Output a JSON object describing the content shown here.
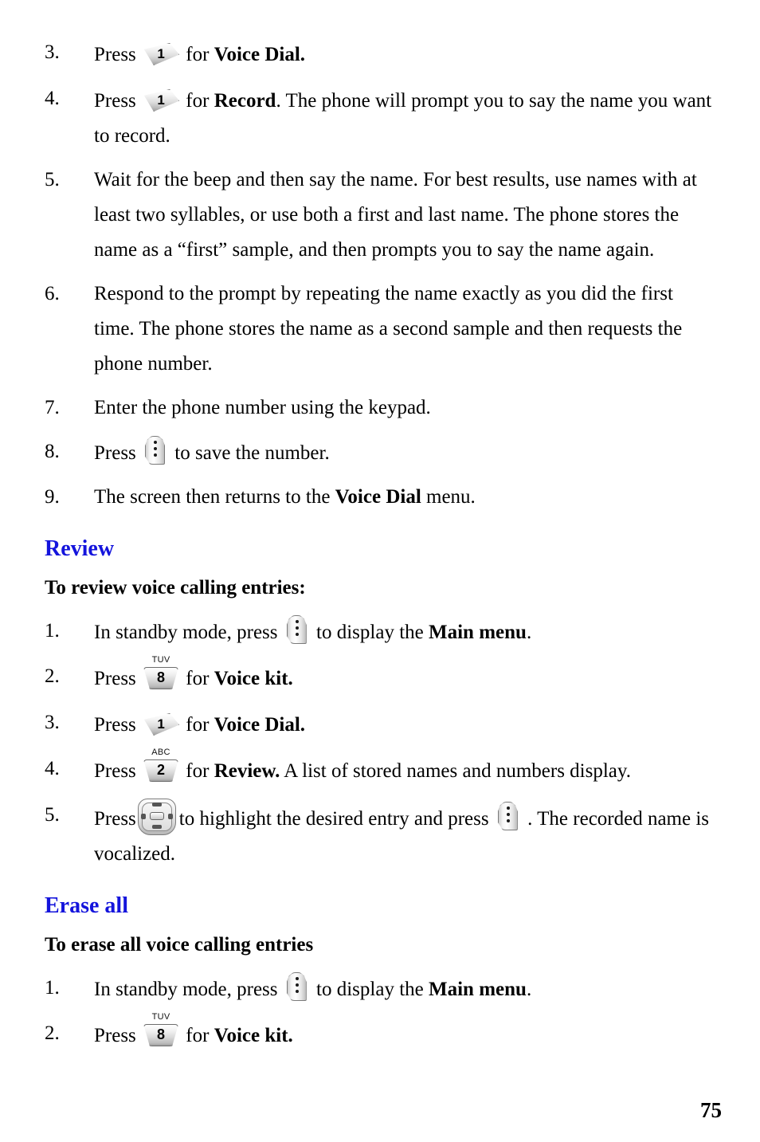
{
  "document": {
    "page_number": "75",
    "heading_color": "#1414dc",
    "text_color": "#000000",
    "background_color": "#ffffff"
  },
  "icons": {
    "key_one": {
      "name": "phone-key-1",
      "digit": "1",
      "letters": ""
    },
    "key_two": {
      "name": "phone-key-2",
      "digit": "2",
      "letters": "ABC"
    },
    "key_eight": {
      "name": "phone-key-8",
      "digit": "8",
      "letters": "TUV"
    },
    "key_menu": {
      "name": "phone-menu-key"
    },
    "key_nav": {
      "name": "phone-navigation-key"
    }
  },
  "blocks": [
    {
      "type": "step",
      "num": "3.",
      "segments": [
        {
          "t": "text",
          "v": "Press "
        },
        {
          "t": "icon",
          "v": "key_one"
        },
        {
          "t": "text",
          "v": " for "
        },
        {
          "t": "bold",
          "v": "Voice Dial."
        }
      ]
    },
    {
      "type": "step",
      "num": "4.",
      "segments": [
        {
          "t": "text",
          "v": "Press "
        },
        {
          "t": "icon",
          "v": "key_one"
        },
        {
          "t": "text",
          "v": " for "
        },
        {
          "t": "bold",
          "v": "Record"
        },
        {
          "t": "text",
          "v": ". The phone will prompt you to say the name you want to record."
        }
      ]
    },
    {
      "type": "step",
      "num": "5.",
      "segments": [
        {
          "t": "text",
          "v": "Wait for the beep and then say the name. For best results, use names with at least two syllables, or use both a first and last name. The phone stores the name as a “first” sample, and then prompts you to say the name again."
        }
      ]
    },
    {
      "type": "step",
      "num": "6.",
      "segments": [
        {
          "t": "text",
          "v": "Respond to the prompt by repeating the name exactly as you did the first time. The phone stores the name as a second sample and then requests the phone number."
        }
      ]
    },
    {
      "type": "step",
      "num": "7.",
      "segments": [
        {
          "t": "text",
          "v": "Enter the phone number using the keypad."
        }
      ]
    },
    {
      "type": "step",
      "num": "8.",
      "segments": [
        {
          "t": "text",
          "v": "Press "
        },
        {
          "t": "icon",
          "v": "key_menu"
        },
        {
          "t": "text",
          "v": "  to save the number."
        }
      ]
    },
    {
      "type": "step",
      "num": "9.",
      "segments": [
        {
          "t": "text",
          "v": "The screen then returns to the "
        },
        {
          "t": "bold",
          "v": "Voice Dial"
        },
        {
          "t": "text",
          "v": " menu."
        }
      ]
    },
    {
      "type": "section-heading",
      "text": "Review"
    },
    {
      "type": "sub-heading",
      "text": "To review voice calling entries:"
    },
    {
      "type": "step",
      "num": "1.",
      "segments": [
        {
          "t": "text",
          "v": "In standby mode, press "
        },
        {
          "t": "icon",
          "v": "key_menu"
        },
        {
          "t": "text",
          "v": "  to display the "
        },
        {
          "t": "bold",
          "v": "Main menu"
        },
        {
          "t": "text",
          "v": "."
        }
      ]
    },
    {
      "type": "step",
      "num": "2.",
      "segments": [
        {
          "t": "text",
          "v": "Press "
        },
        {
          "t": "icon",
          "v": "key_eight"
        },
        {
          "t": "text",
          "v": " for "
        },
        {
          "t": "bold",
          "v": "Voice kit."
        }
      ]
    },
    {
      "type": "step",
      "num": "3.",
      "segments": [
        {
          "t": "text",
          "v": "Press "
        },
        {
          "t": "icon",
          "v": "key_one"
        },
        {
          "t": "text",
          "v": " for "
        },
        {
          "t": "bold",
          "v": "Voice Dial."
        }
      ]
    },
    {
      "type": "step",
      "num": "4.",
      "segments": [
        {
          "t": "text",
          "v": "Press "
        },
        {
          "t": "icon",
          "v": "key_two"
        },
        {
          "t": "text",
          "v": " for "
        },
        {
          "t": "bold",
          "v": "Review."
        },
        {
          "t": "text",
          "v": " A list of stored names and numbers display."
        }
      ]
    },
    {
      "type": "step",
      "num": "5.",
      "segments": [
        {
          "t": "text",
          "v": "Press"
        },
        {
          "t": "icon",
          "v": "key_nav"
        },
        {
          "t": "text",
          "v": "to highlight the desired entry and press "
        },
        {
          "t": "icon",
          "v": "key_menu"
        },
        {
          "t": "text",
          "v": " . The recorded name is vocalized."
        }
      ]
    },
    {
      "type": "section-heading",
      "text": "Erase all"
    },
    {
      "type": "sub-heading",
      "text": "To erase all voice calling entries"
    },
    {
      "type": "step",
      "num": "1.",
      "segments": [
        {
          "t": "text",
          "v": "In standby mode, press "
        },
        {
          "t": "icon",
          "v": "key_menu"
        },
        {
          "t": "text",
          "v": "  to display the "
        },
        {
          "t": "bold",
          "v": "Main menu"
        },
        {
          "t": "text",
          "v": "."
        }
      ]
    },
    {
      "type": "step",
      "num": "2.",
      "segments": [
        {
          "t": "text",
          "v": "Press "
        },
        {
          "t": "icon",
          "v": "key_eight"
        },
        {
          "t": "text",
          "v": " for "
        },
        {
          "t": "bold",
          "v": "Voice kit."
        }
      ]
    }
  ]
}
